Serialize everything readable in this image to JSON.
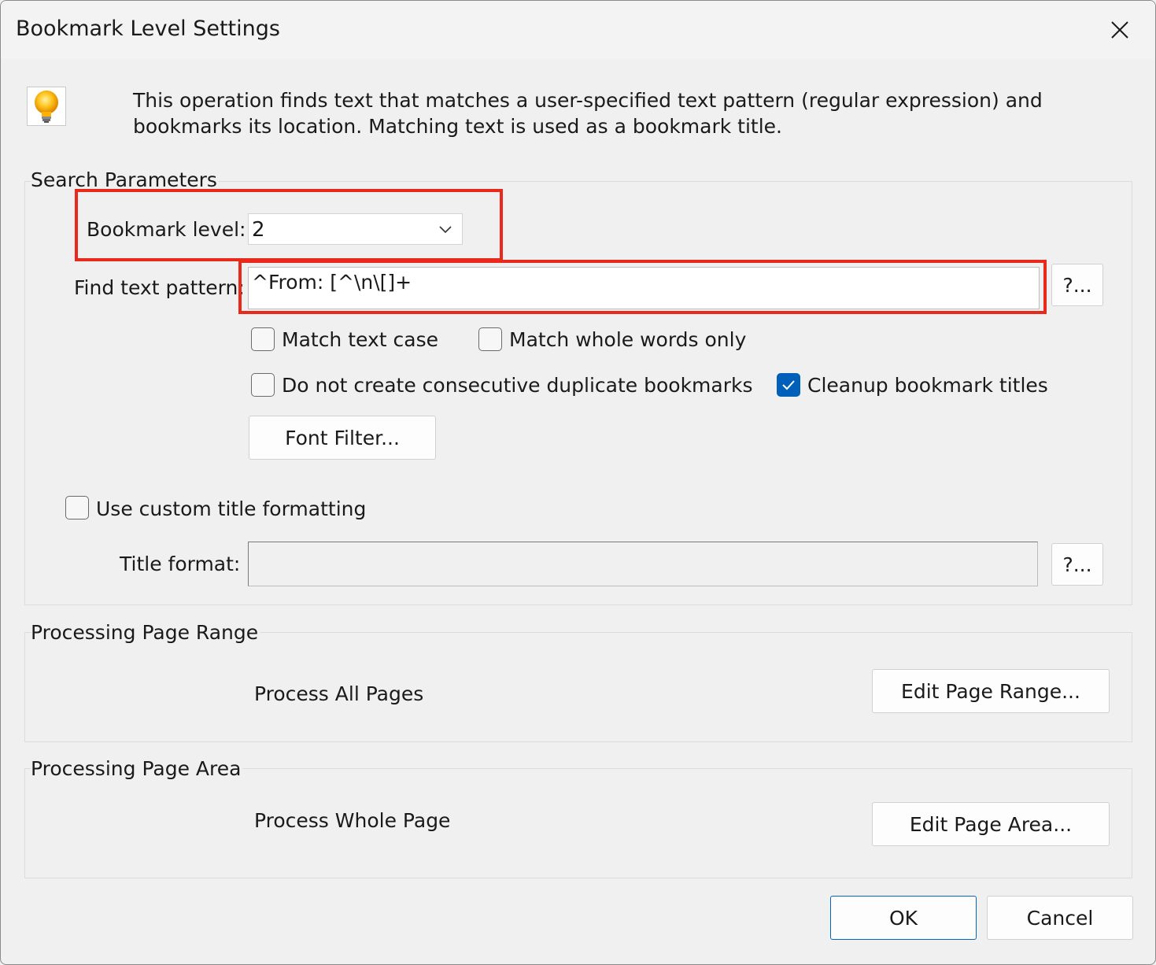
{
  "window": {
    "title": "Bookmark Level Settings"
  },
  "description": "This operation finds text that matches a user-specified text pattern (regular expression) and bookmarks its location. Matching text is used as a bookmark title.",
  "search": {
    "group_label": "Search Parameters",
    "bookmark_level_label": "Bookmark level:",
    "bookmark_level_value": "2",
    "find_pattern_label": "Find text pattern:",
    "find_pattern_value": "^From: [^\\n\\[]+",
    "help_button": "?...",
    "match_case_label": "Match text case",
    "match_case_checked": false,
    "whole_words_label": "Match whole words only",
    "whole_words_checked": false,
    "no_duplicates_label": "Do not create consecutive duplicate bookmarks",
    "no_duplicates_checked": false,
    "cleanup_label": "Cleanup bookmark titles",
    "cleanup_checked": true,
    "font_filter_button": "Font Filter...",
    "custom_format_label": "Use custom title formatting",
    "custom_format_checked": false,
    "title_format_label": "Title format:",
    "title_format_value": "",
    "title_help_button": "?..."
  },
  "page_range": {
    "group_label": "Processing Page Range",
    "status": "Process All Pages",
    "edit_button": "Edit Page Range..."
  },
  "page_area": {
    "group_label": "Processing Page Area",
    "status": "Process Whole Page",
    "edit_button": "Edit Page Area..."
  },
  "footer": {
    "ok_button": "OK",
    "cancel_button": "Cancel"
  },
  "colors": {
    "highlight": "#e8291c",
    "accent": "#005fb8"
  }
}
